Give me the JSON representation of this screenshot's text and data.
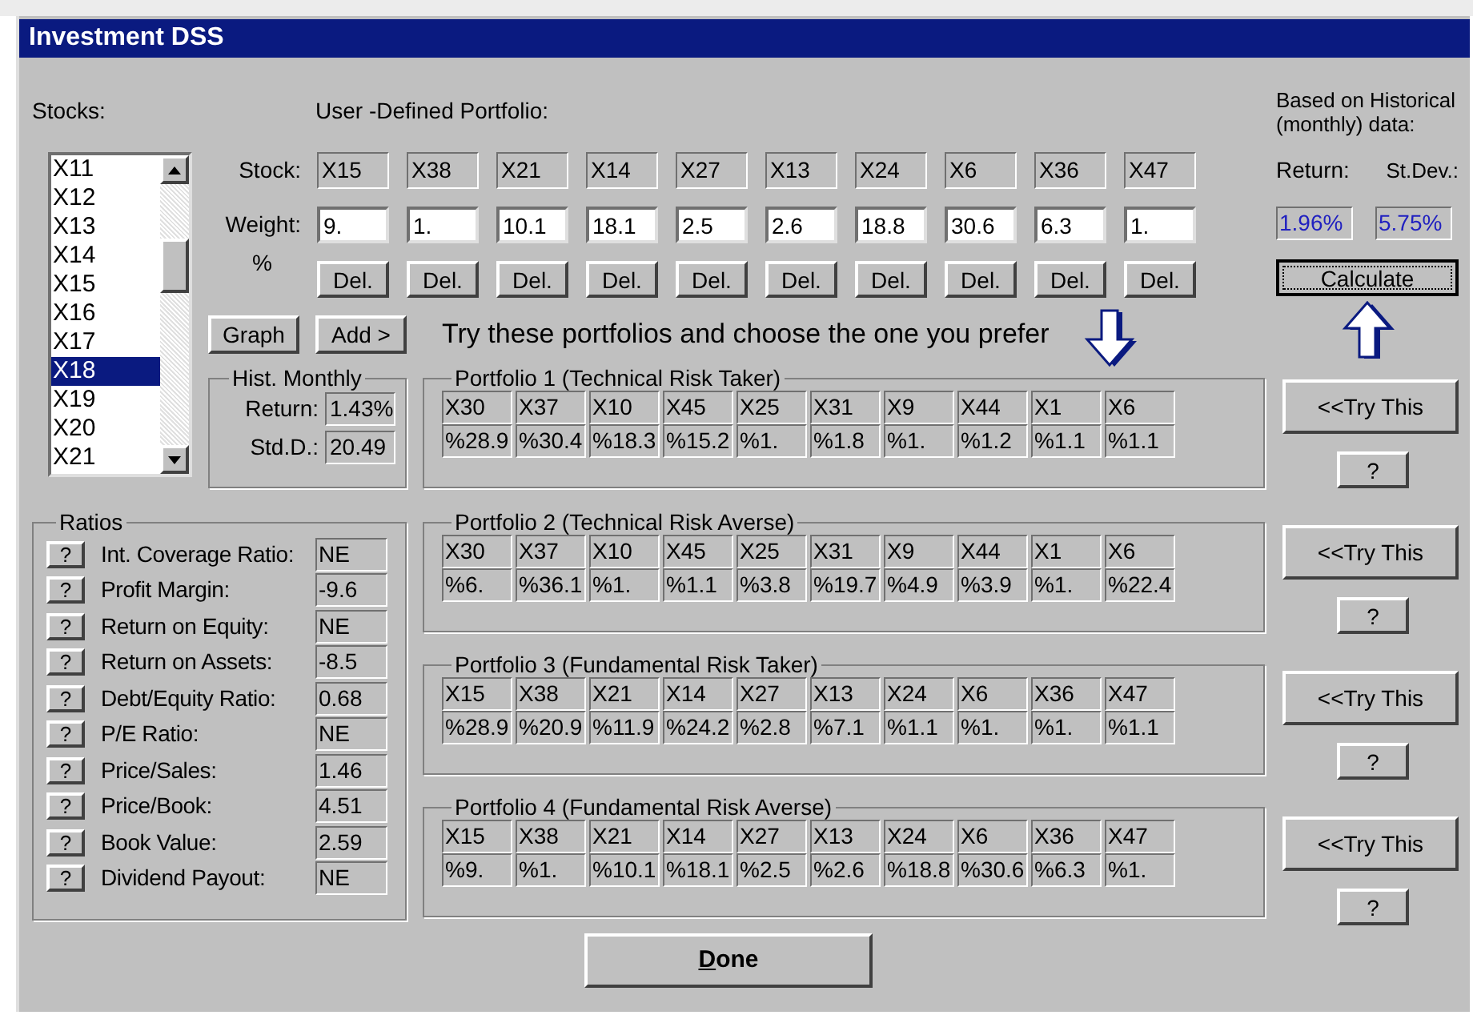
{
  "window": {
    "title": "Investment DSS"
  },
  "stocks": {
    "label": "Stocks:",
    "items": [
      {
        "label": "X11",
        "selected": false
      },
      {
        "label": "X12",
        "selected": false
      },
      {
        "label": "X13",
        "selected": false
      },
      {
        "label": "X14",
        "selected": false
      },
      {
        "label": "X15",
        "selected": false
      },
      {
        "label": "X16",
        "selected": false
      },
      {
        "label": "X17",
        "selected": false
      },
      {
        "label": "X18",
        "selected": true
      },
      {
        "label": "X19",
        "selected": false
      },
      {
        "label": "X20",
        "selected": false
      },
      {
        "label": "X21",
        "selected": false
      }
    ]
  },
  "user_portfolio": {
    "label": "User -Defined Portfolio:",
    "stock_label": "Stock:",
    "weight_label": "Weight:",
    "weight_unit": "%",
    "stocks": [
      "X15",
      "X38",
      "X21",
      "X14",
      "X27",
      "X13",
      "X24",
      "X6",
      "X36",
      "X47"
    ],
    "weights": [
      "9.",
      "1.",
      "10.1",
      "18.1",
      "2.5",
      "2.6",
      "18.8",
      "30.6",
      "6.3",
      "1."
    ],
    "delete_buttons": [
      "Del.",
      "Del.",
      "Del.",
      "Del.",
      "Del.",
      "Del.",
      "Del.",
      "Del.",
      "Del.",
      "Del."
    ]
  },
  "graph_button": "Graph",
  "add_button": "Add >",
  "prompt": "Try these portfolios and choose the one you prefer",
  "hist_monthly": {
    "title": "Hist. Monthly",
    "rows": [
      {
        "label": "Return:",
        "value": "1.43%"
      },
      {
        "label": "Std.D.:",
        "value": "20.49"
      }
    ]
  },
  "historical": {
    "note": "Based on Historical (monthly) data:",
    "return_label": "Return:",
    "stdev_label": "St.Dev.:",
    "return_value": "1.96%",
    "stdev_value": "5.75%",
    "calculate_button": "Calculate"
  },
  "ratios": {
    "title": "Ratios",
    "items": [
      {
        "help": "?",
        "label": "Int. Coverage Ratio:",
        "value": "NE"
      },
      {
        "help": "?",
        "label": "Profit Margin:",
        "value": "-9.6"
      },
      {
        "help": "?",
        "label": "Return on Equity:",
        "value": "NE"
      },
      {
        "help": "?",
        "label": "Return on Assets:",
        "value": "-8.5"
      },
      {
        "help": "?",
        "label": "Debt/Equity Ratio:",
        "value": "0.68"
      },
      {
        "help": "?",
        "label": "P/E Ratio:",
        "value": "NE"
      },
      {
        "help": "?",
        "label": "Price/Sales:",
        "value": "1.46"
      },
      {
        "help": "?",
        "label": "Price/Book:",
        "value": "4.51"
      },
      {
        "help": "?",
        "label": "Book Value:",
        "value": "2.59"
      },
      {
        "help": "?",
        "label": "Dividend Payout:",
        "value": "NE"
      }
    ]
  },
  "portfolios": [
    {
      "title": "Portfolio 1 (Technical Risk Taker)",
      "stocks": [
        "X30",
        "X37",
        "X10",
        "X45",
        "X25",
        "X31",
        "X9",
        "X44",
        "X1",
        "X6"
      ],
      "weights": [
        "%28.9",
        "%30.4",
        "%18.3",
        "%15.2",
        "%1.",
        "%1.8",
        "%1.",
        "%1.2",
        "%1.1",
        "%1.1"
      ],
      "try_button": "<<Try This",
      "help_button": "?"
    },
    {
      "title": "Portfolio 2 (Technical Risk Averse)",
      "stocks": [
        "X30",
        "X37",
        "X10",
        "X45",
        "X25",
        "X31",
        "X9",
        "X44",
        "X1",
        "X6"
      ],
      "weights": [
        "%6.",
        "%36.1",
        "%1.",
        "%1.1",
        "%3.8",
        "%19.7",
        "%4.9",
        "%3.9",
        "%1.",
        "%22.4"
      ],
      "try_button": "<<Try This",
      "help_button": "?"
    },
    {
      "title": "Portfolio 3 (Fundamental Risk Taker)",
      "stocks": [
        "X15",
        "X38",
        "X21",
        "X14",
        "X27",
        "X13",
        "X24",
        "X6",
        "X36",
        "X47"
      ],
      "weights": [
        "%28.9",
        "%20.9",
        "%11.9",
        "%24.2",
        "%2.8",
        "%7.1",
        "%1.1",
        "%1.",
        "%1.",
        "%1.1"
      ],
      "try_button": "<<Try This",
      "help_button": "?"
    },
    {
      "title": "Portfolio 4 (Fundamental Risk Averse)",
      "stocks": [
        "X15",
        "X38",
        "X21",
        "X14",
        "X27",
        "X13",
        "X24",
        "X6",
        "X36",
        "X47"
      ],
      "weights": [
        "%9.",
        "%1.",
        "%10.1",
        "%18.1",
        "%2.5",
        "%2.6",
        "%18.8",
        "%30.6",
        "%6.3",
        "%1."
      ],
      "try_button": "<<Try This",
      "help_button": "?"
    }
  ],
  "done_button": "Done"
}
